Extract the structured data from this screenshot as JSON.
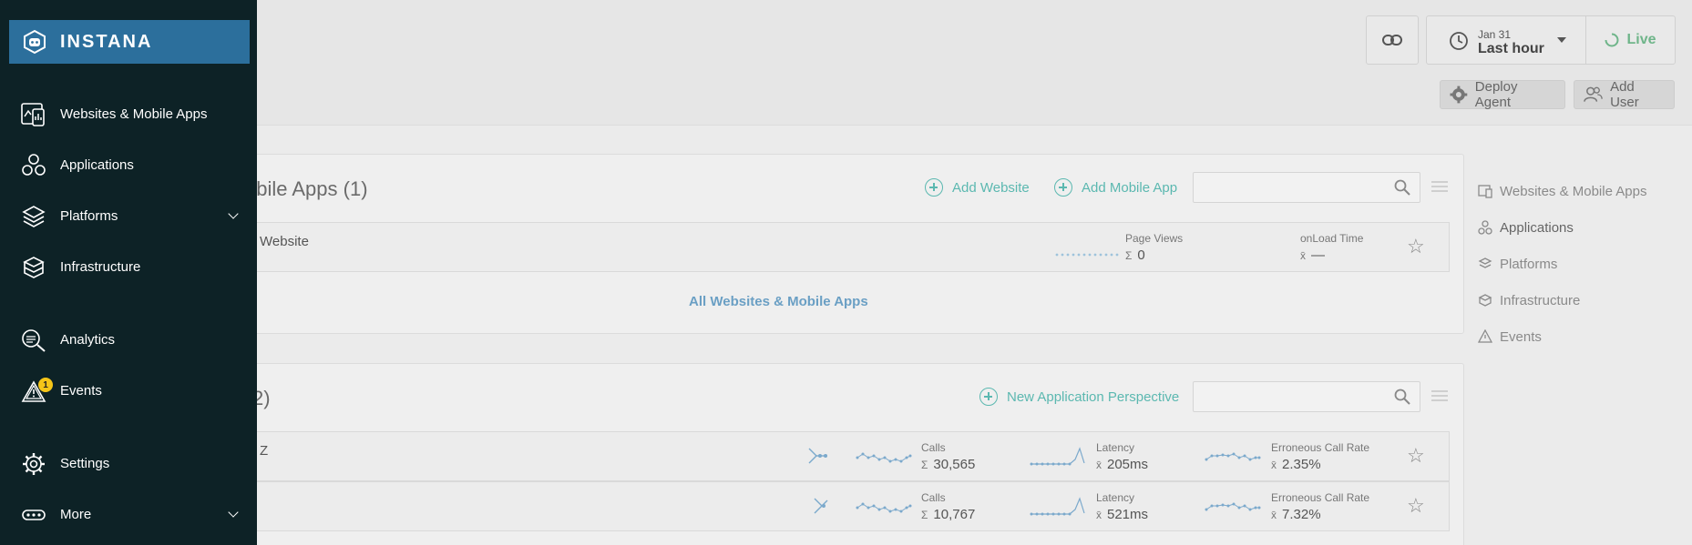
{
  "sidebar": {
    "brand": "INSTANA",
    "items": [
      {
        "label": "Websites & Mobile Apps"
      },
      {
        "label": "Applications"
      },
      {
        "label": "Platforms"
      },
      {
        "label": "Infrastructure"
      },
      {
        "label": "Analytics"
      },
      {
        "label": "Events",
        "badge": "1"
      },
      {
        "label": "Settings"
      },
      {
        "label": "More"
      }
    ]
  },
  "header": {
    "date": "Jan 31",
    "range": "Last hour",
    "live": "Live",
    "deploy_agent": "Deploy Agent",
    "add_user": "Add User"
  },
  "websites_card": {
    "title": "obile Apps (1)",
    "add_website": "Add Website",
    "add_mobile_app": "Add Mobile App",
    "row": {
      "name": "Website",
      "page_views_label": "Page Views",
      "page_views_value": "0",
      "onload_label": "onLoad Time",
      "onload_value": "—"
    },
    "all_link": "All Websites & Mobile Apps"
  },
  "apps_card": {
    "title": "2)",
    "new_perspective": "New Application Perspective",
    "rows": [
      {
        "name": "Z",
        "calls_label": "Calls",
        "calls": "30,565",
        "latency_label": "Latency",
        "latency": "205ms",
        "err_label": "Erroneous Call Rate",
        "err": "2.35%"
      },
      {
        "name": "",
        "calls_label": "Calls",
        "calls": "10,767",
        "latency_label": "Latency",
        "latency": "521ms",
        "err_label": "Erroneous Call Rate",
        "err": "7.32%"
      }
    ]
  },
  "right_nav": [
    {
      "label": "Websites & Mobile Apps"
    },
    {
      "label": "Applications"
    },
    {
      "label": "Platforms"
    },
    {
      "label": "Infrastructure"
    },
    {
      "label": "Events"
    }
  ],
  "icons": {
    "link": "link-icon",
    "clock": "clock-icon",
    "gear": "gear-icon",
    "user": "users-icon",
    "search": "search-icon",
    "star": "star-icon"
  },
  "colors": {
    "sidebar_bg": "#0d2226",
    "brand_bg": "#2c6f9c",
    "accent": "#5bb8b0",
    "live": "#6fb58a",
    "link": "#6a9fc4",
    "badge": "#f5c518"
  }
}
